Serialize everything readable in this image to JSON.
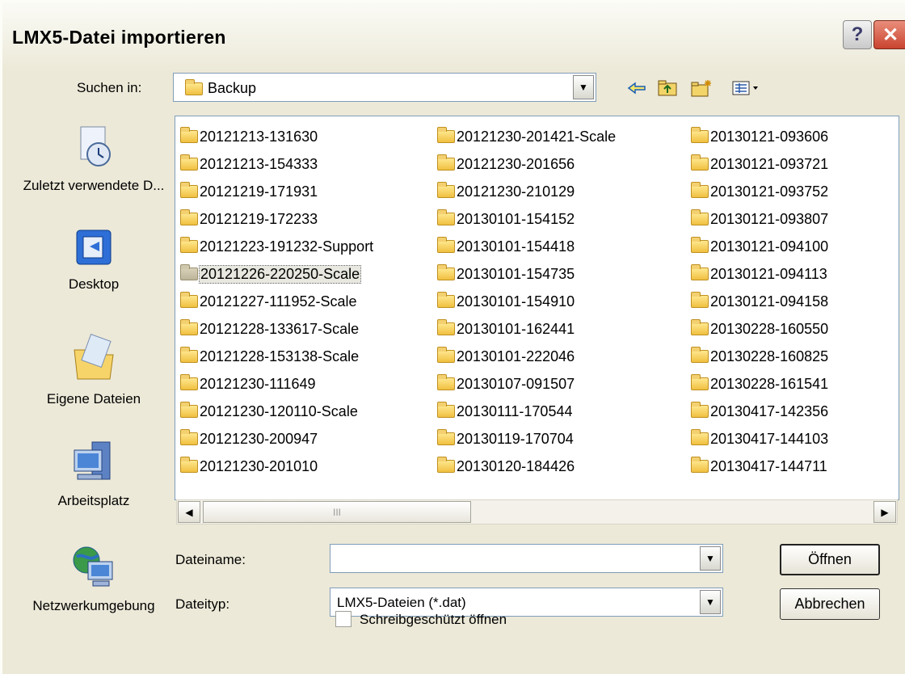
{
  "dialog": {
    "title": "LMX5-Datei importieren",
    "help_label": "?",
    "close_label": "✕"
  },
  "look_in": {
    "label": "Suchen in:",
    "value": "Backup"
  },
  "toolbar": {
    "back_icon": "back-arrow-icon",
    "up_icon": "folder-up-icon",
    "new_folder_icon": "new-folder-icon",
    "view_icon": "view-menu-icon"
  },
  "places": [
    {
      "label": "Zuletzt verwendete D...",
      "icon": "recent-documents-icon"
    },
    {
      "label": "Desktop",
      "icon": "desktop-icon"
    },
    {
      "label": "Eigene Dateien",
      "icon": "my-documents-icon"
    },
    {
      "label": "Arbeitsplatz",
      "icon": "my-computer-icon"
    },
    {
      "label": "Netzwerkumgebung",
      "icon": "network-icon"
    }
  ],
  "files": {
    "col1": [
      "20121213-131630",
      "20121213-154333",
      "20121219-171931",
      "20121219-172233",
      "20121223-191232-Support",
      "20121226-220250-Scale",
      "20121227-111952-Scale",
      "20121228-133617-Scale",
      "20121228-153138-Scale",
      "20121230-111649",
      "20121230-120110-Scale",
      "20121230-200947",
      "20121230-201010"
    ],
    "col2": [
      "20121230-201421-Scale",
      "20121230-201656",
      "20121230-210129",
      "20130101-154152",
      "20130101-154418",
      "20130101-154735",
      "20130101-154910",
      "20130101-162441",
      "20130101-222046",
      "20130107-091507",
      "20130111-170544",
      "20130119-170704",
      "20130120-184426"
    ],
    "col3": [
      "20130121-093606",
      "20130121-093721",
      "20130121-093752",
      "20130121-093807",
      "20130121-094100",
      "20130121-094113",
      "20130121-094158",
      "20130228-160550",
      "20130228-160825",
      "20130228-161541",
      "20130417-142356",
      "20130417-144103",
      "20130417-144711"
    ],
    "selected": "20121226-220250-Scale"
  },
  "scrollbar": {
    "grip": "III"
  },
  "filename": {
    "label": "Dateiname:",
    "value": ""
  },
  "filetype": {
    "label": "Dateityp:",
    "value": "LMX5-Dateien  (*.dat)"
  },
  "readonly": {
    "label": "Schreibgeschützt öffnen",
    "checked": false
  },
  "buttons": {
    "open": "Öffnen",
    "cancel": "Abbrechen"
  }
}
